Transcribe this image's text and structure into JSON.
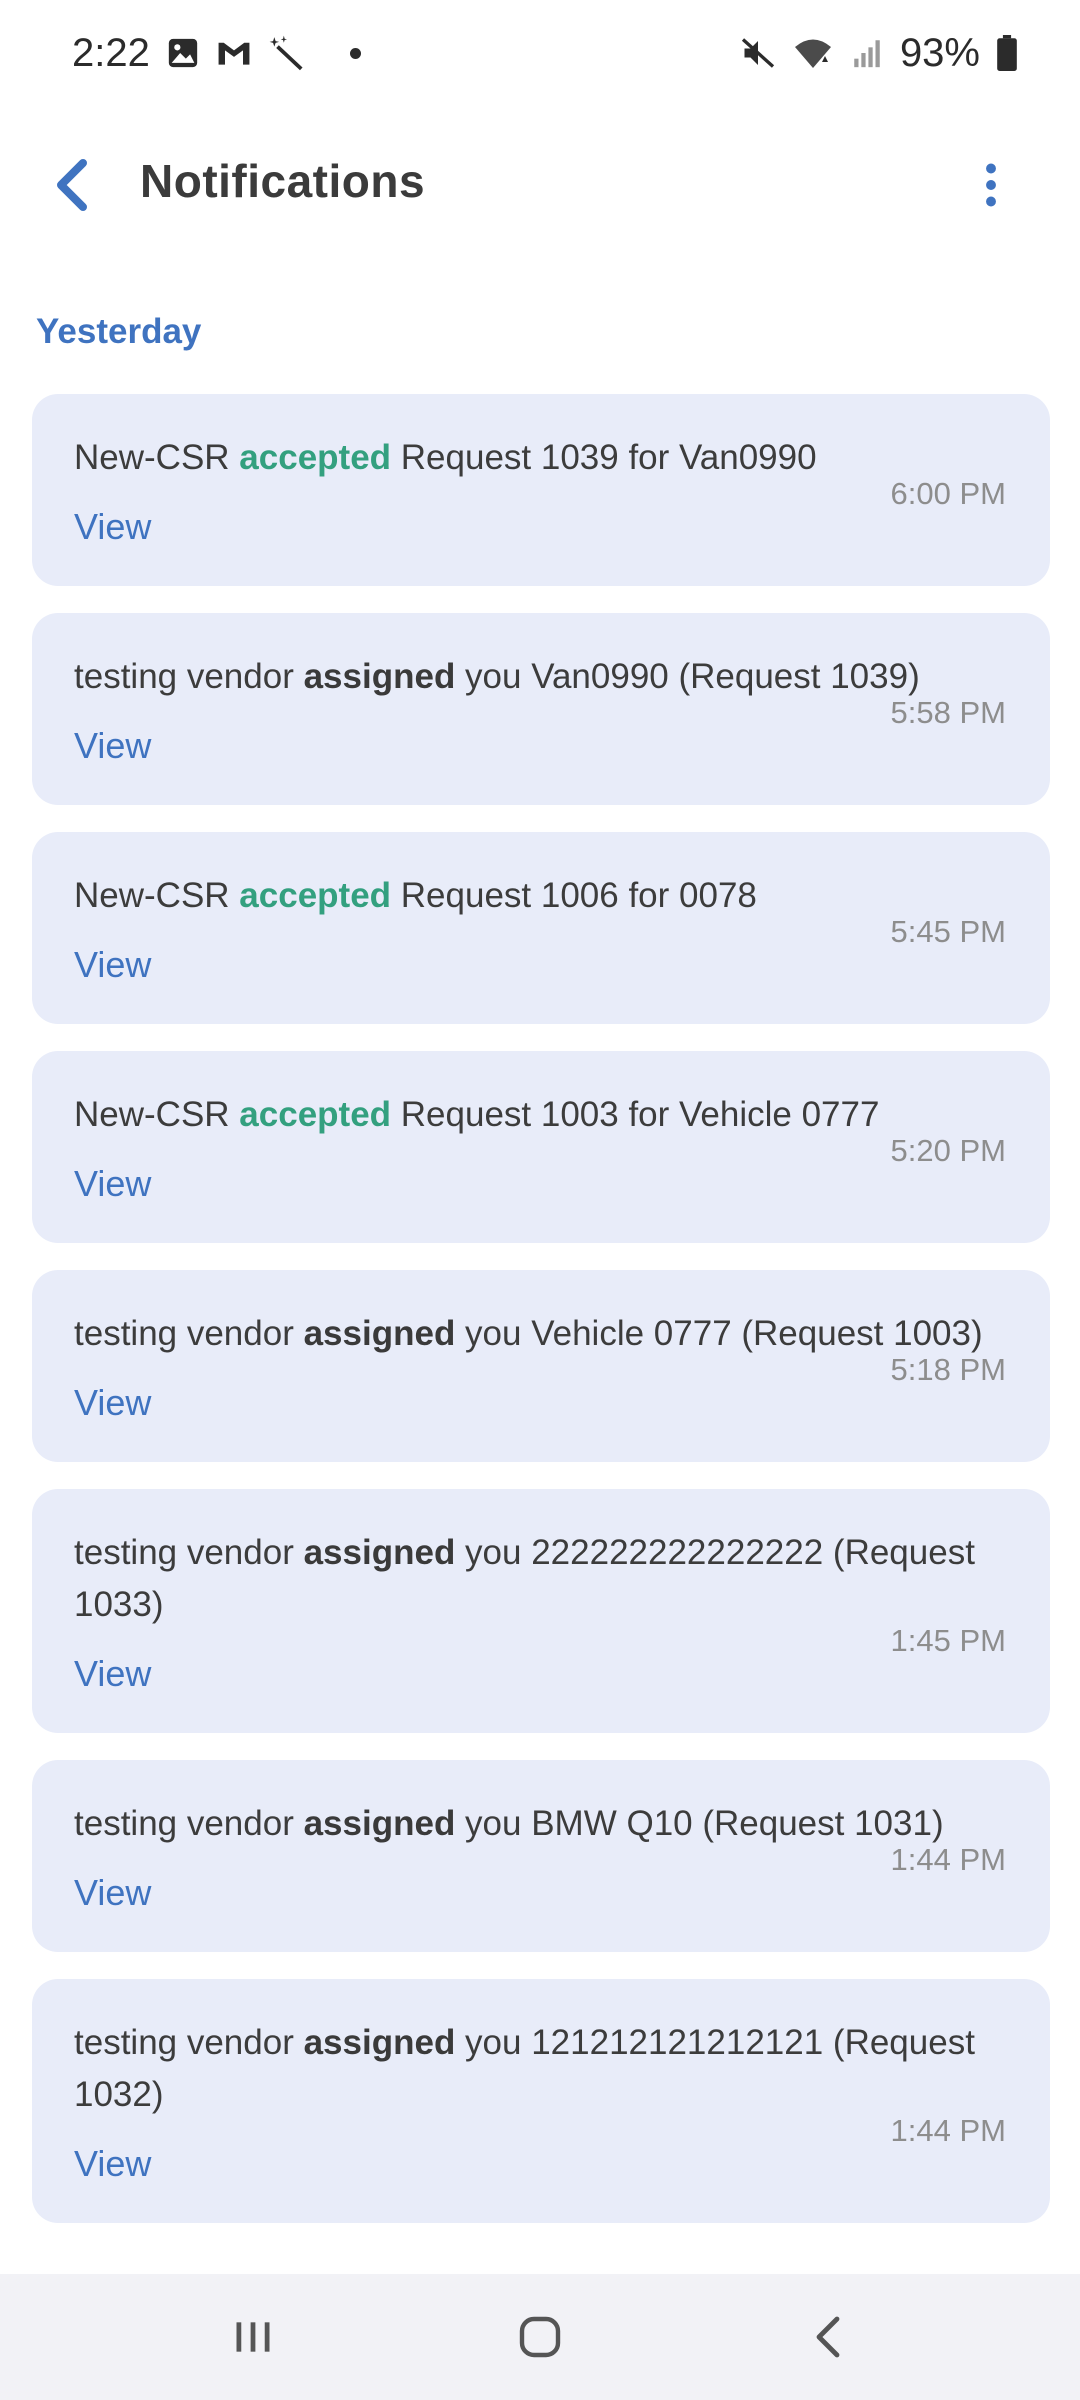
{
  "status_bar": {
    "time": "2:22",
    "battery": "93%",
    "icons": [
      "image-icon",
      "gmail-icon",
      "magic-wand-icon",
      "mute-icon",
      "wifi-icon",
      "signal-icon",
      "battery-icon"
    ]
  },
  "app_bar": {
    "title": "Notifications",
    "back_icon": "back-chevron-icon",
    "menu_icon": "more-vert-icon"
  },
  "section": {
    "label": "Yesterday"
  },
  "colors": {
    "accent": "#3f73c0",
    "accepted": "#33a07f",
    "card_bg": "#e8ecf9"
  },
  "notifications": [
    {
      "actor": "New-CSR ",
      "verb": "accepted",
      "rest": " Request 1039 for Van0990",
      "time": "6:00 PM",
      "view_label": "View"
    },
    {
      "actor": "testing vendor ",
      "verb": "assigned",
      "rest": " you Van0990 (Request 1039)",
      "time": "5:58 PM",
      "view_label": "View"
    },
    {
      "actor": "New-CSR ",
      "verb": "accepted",
      "rest": " Request 1006 for 0078",
      "time": "5:45 PM",
      "view_label": "View"
    },
    {
      "actor": "New-CSR ",
      "verb": "accepted",
      "rest": " Request 1003 for Vehicle 0777",
      "time": "5:20 PM",
      "view_label": "View"
    },
    {
      "actor": "testing vendor ",
      "verb": "assigned",
      "rest": " you Vehicle 0777 (Request 1003)",
      "time": "5:18 PM",
      "view_label": "View"
    },
    {
      "actor": "testing vendor ",
      "verb": "assigned",
      "rest": " you 222222222222222 (Request 1033)",
      "time": "1:45 PM",
      "view_label": "View"
    },
    {
      "actor": "testing vendor ",
      "verb": "assigned",
      "rest": " you BMW Q10  (Request 1031)",
      "time": "1:44 PM",
      "view_label": "View"
    },
    {
      "actor": "testing vendor ",
      "verb": "assigned",
      "rest": " you 121212121212121 (Request 1032)",
      "time": "1:44 PM",
      "view_label": "View"
    }
  ],
  "nav_bar": {
    "recents_icon": "recents-icon",
    "home_icon": "home-icon",
    "back_icon": "nav-back-icon"
  }
}
